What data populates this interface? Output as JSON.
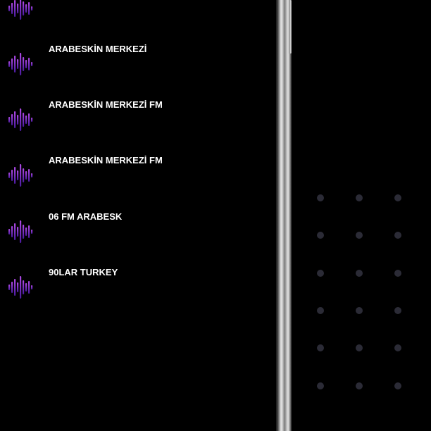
{
  "stations": [
    {
      "name": ""
    },
    {
      "name": "ARABESKİN MERKEZİ"
    },
    {
      "name": "ARABESKİN MERKEZİ FM"
    },
    {
      "name": "ARABESKİN MERKEZİ FM"
    },
    {
      "name": "06 FM ARABESK"
    },
    {
      "name": "90LAR TURKEY"
    }
  ],
  "station_icon": "audio-wave-icon",
  "colors": {
    "background": "#000000",
    "wave_gradient_top": "#b04ae6",
    "wave_gradient_bottom": "#4a1a9e",
    "station_text": "#ffffff",
    "dot": "#2b2b36"
  }
}
